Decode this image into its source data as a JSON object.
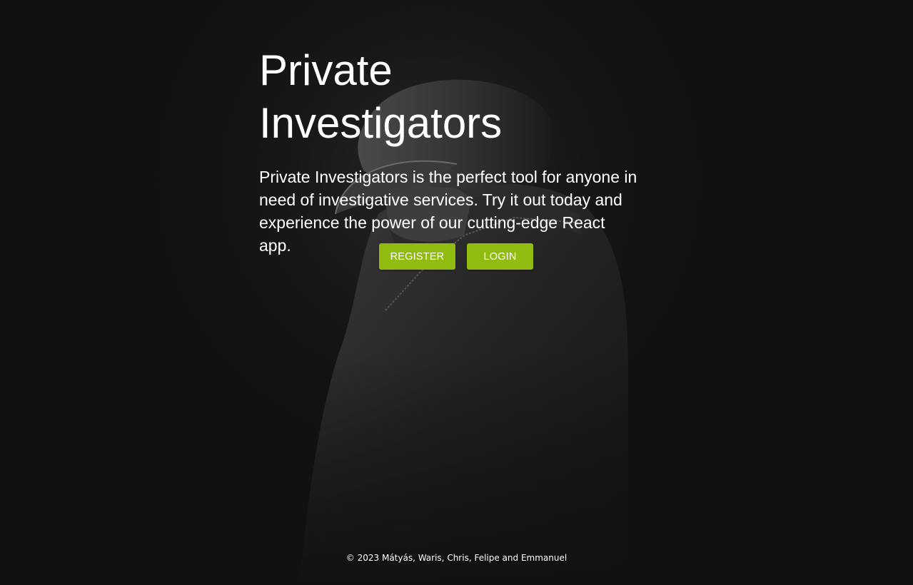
{
  "hero": {
    "title": "Private Investigators",
    "description": "Private Investigators is the perfect tool for anyone in need of investigative services. Try it out today and experience the power of our cutting-edge React app."
  },
  "actions": {
    "register_label": "REGISTER",
    "login_label": "LOGIN"
  },
  "footer": {
    "copyright": "© 2023 Mátyás, Waris, Chris, Felipe and Emmanuel"
  },
  "colors": {
    "background": "#111111",
    "accent": "#8fbc0f",
    "text": "#ffffff"
  },
  "background_image": "detective-in-cap-photo"
}
